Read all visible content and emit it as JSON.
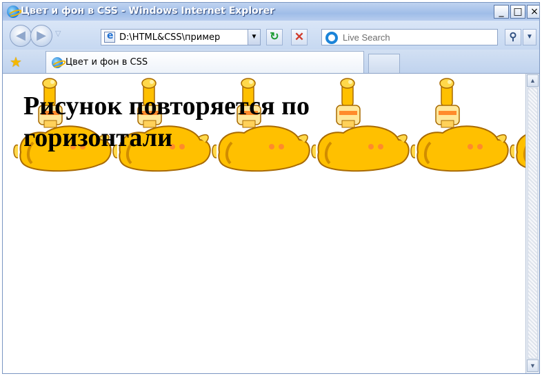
{
  "window": {
    "title": "Цвет и фон в CSS - Windows Internet Explorer",
    "minimize_glyph": "_",
    "maximize_glyph": "□",
    "close_glyph": "×"
  },
  "navigation": {
    "back_glyph": "◀",
    "forward_glyph": "▶",
    "history_glyph": "▽",
    "address_value": "D:\\HTML&CSS\\пример",
    "address_dropdown_glyph": "▼",
    "refresh_glyph": "↻",
    "stop_glyph": "✕",
    "search_placeholder": "Live Search",
    "search_glyph": "⚲",
    "search_dropdown_glyph": "▼"
  },
  "tabs": {
    "favorites_glyph": "★",
    "active_tab_label": "Цвет и фон в CSS"
  },
  "page": {
    "heading": "Рисунок повторяется по горизонтали",
    "background_image": "yellow-submarine-repeat-x"
  },
  "scrollbar": {
    "up_glyph": "▲",
    "down_glyph": "▼"
  },
  "colors": {
    "submarine_yellow": "#ffc000",
    "submarine_outline": "#a86a00",
    "titlebar": "#9fbde8",
    "window_border": "#7a96c2"
  }
}
